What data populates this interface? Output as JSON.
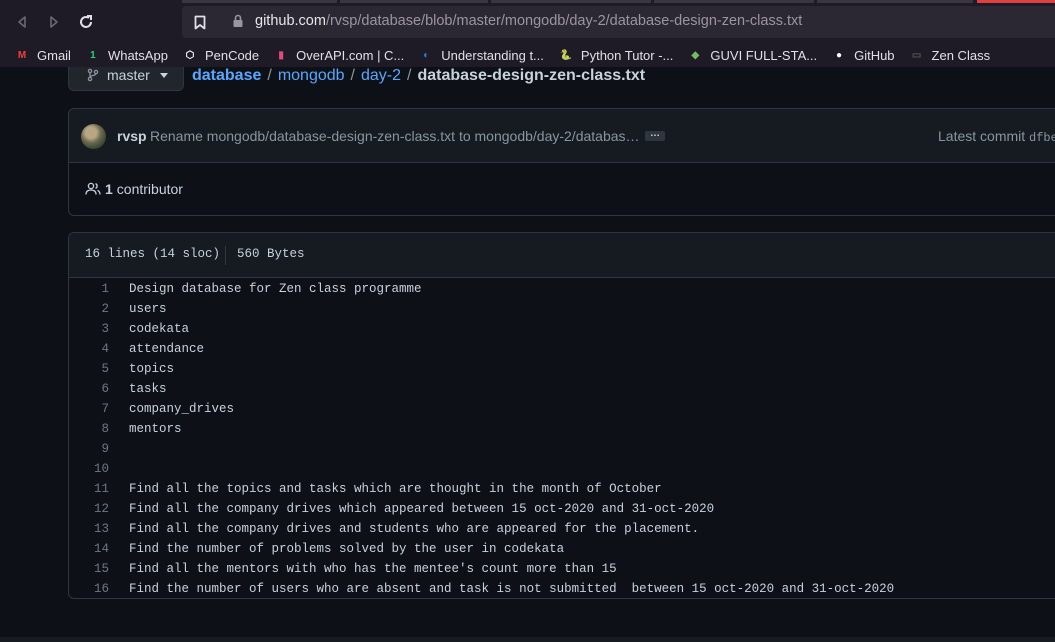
{
  "browser": {
    "url_host": "github.com",
    "url_path": "/rvsp/database/blob/master/mongodb/day-2/database-design-zen-class.txt",
    "back_icon": "arrow-left-icon",
    "forward_icon": "arrow-right-icon",
    "reload_icon": "reload-icon"
  },
  "bookmarks": [
    {
      "label": "Gmail",
      "icon": "gmail-icon",
      "color": "#ea4335",
      "glyph": "M"
    },
    {
      "label": "WhatsApp",
      "icon": "whatsapp-icon",
      "color": "#25d366",
      "glyph": "1"
    },
    {
      "label": "PenCode",
      "icon": "pencode-icon",
      "color": "#ffffff",
      "glyph": "⬡"
    },
    {
      "label": "OverAPI.com | C...",
      "icon": "overapi-icon",
      "color": "#e24a7a",
      "glyph": "▮"
    },
    {
      "label": "Understanding t...",
      "icon": "understanding-icon",
      "color": "#1e88e5",
      "glyph": "◐"
    },
    {
      "label": "Python Tutor -...",
      "icon": "python-icon",
      "color": "#ffd43b",
      "glyph": "🐍"
    },
    {
      "label": "GUVI FULL-STA...",
      "icon": "guvi-icon",
      "color": "#6dbd64",
      "glyph": "◆"
    },
    {
      "label": "GitHub",
      "icon": "github-icon",
      "color": "#ffffff",
      "glyph": "●"
    },
    {
      "label": "Zen Class",
      "icon": "zen-icon",
      "color": "#555555",
      "glyph": "▭"
    }
  ],
  "repo": {
    "branch": "master",
    "crumbs": [
      "database",
      "mongodb",
      "day-2"
    ],
    "file": "database-design-zen-class.txt"
  },
  "commit": {
    "author": "rvsp",
    "message": "Rename mongodb/database-design-zen-class.txt to mongodb/day-2/databas…",
    "ellipsis": "…",
    "latest_label": "Latest commit",
    "sha": "dfbe"
  },
  "contributors": {
    "count": "1",
    "label": "contributor"
  },
  "file": {
    "lines_info": "16 lines (14 sloc)",
    "size": "560 Bytes",
    "lines": [
      "Design database for Zen class programme",
      "users",
      "codekata",
      "attendance",
      "topics",
      "tasks",
      "company_drives",
      "mentors",
      "",
      "",
      "Find all the topics and tasks which are thought in the month of October",
      "Find all the company drives which appeared between 15 oct-2020 and 31-oct-2020",
      "Find all the company drives and students who are appeared for the placement.",
      "Find the number of problems solved by the user in codekata",
      "Find all the mentors with who has the mentee's count more than 15",
      "Find the number of users who are absent and task is not submitted  between 15 oct-2020 and 31-oct-2020"
    ]
  }
}
